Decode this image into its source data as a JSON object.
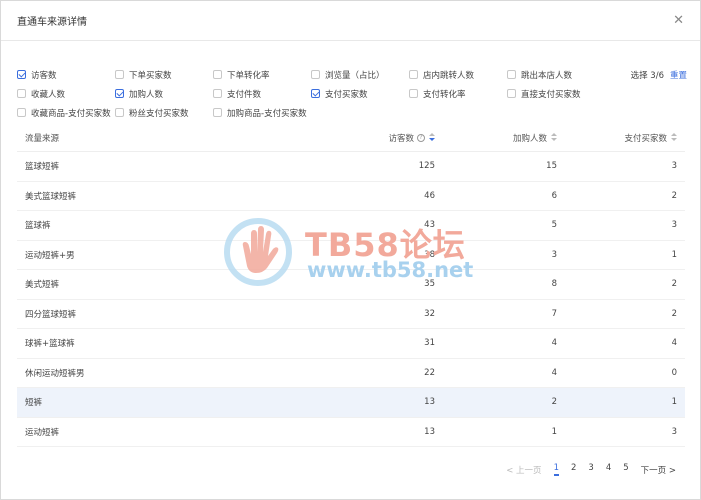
{
  "modal": {
    "title": "直通车来源详情"
  },
  "metrics": {
    "row1": [
      {
        "label": "访客数",
        "checked": true
      },
      {
        "label": "下单买家数",
        "checked": false
      },
      {
        "label": "下单转化率",
        "checked": false
      },
      {
        "label": "浏览量（占比）",
        "checked": false
      },
      {
        "label": "店内跳转人数",
        "checked": false
      },
      {
        "label": "跳出本店人数",
        "checked": false
      }
    ],
    "row2": [
      {
        "label": "收藏人数",
        "checked": false
      },
      {
        "label": "加购人数",
        "checked": true
      },
      {
        "label": "支付件数",
        "checked": false
      },
      {
        "label": "支付买家数",
        "checked": true
      },
      {
        "label": "支付转化率",
        "checked": false
      },
      {
        "label": "直接支付买家数",
        "checked": false
      }
    ],
    "row3": [
      {
        "label": "收藏商品-支付买家数",
        "checked": false
      },
      {
        "label": "粉丝支付买家数",
        "checked": false
      },
      {
        "label": "加购商品-支付买家数",
        "checked": false
      }
    ],
    "select_label": "选择 3/6",
    "reset_label": "重置"
  },
  "table": {
    "headers": [
      "流量来源",
      "访客数",
      "加购人数",
      "支付买家数"
    ],
    "rows": [
      [
        "篮球短裤",
        "125",
        "15",
        "3"
      ],
      [
        "美式篮球短裤",
        "46",
        "6",
        "2"
      ],
      [
        "篮球裤",
        "43",
        "5",
        "3"
      ],
      [
        "运动短裤+男",
        "38",
        "3",
        "1"
      ],
      [
        "美式短裤",
        "35",
        "8",
        "2"
      ],
      [
        "四分篮球短裤",
        "32",
        "7",
        "2"
      ],
      [
        "球裤+篮球裤",
        "31",
        "4",
        "4"
      ],
      [
        "休闲运动短裤男",
        "22",
        "4",
        "0"
      ],
      [
        "短裤",
        "13",
        "2",
        "1"
      ],
      [
        "运动短裤",
        "13",
        "1",
        "3"
      ]
    ],
    "highlighted_row": 8
  },
  "pagination": {
    "prev": "< 上一页",
    "pages": [
      "1",
      "2",
      "3",
      "4",
      "5"
    ],
    "current": "1",
    "next": "下一页 >"
  },
  "watermark": {
    "line1": "TB58论坛",
    "line2": "www.tb58.net"
  },
  "colors": {
    "accent": "#3b6ede",
    "highlight_row": "#eef3fb"
  }
}
